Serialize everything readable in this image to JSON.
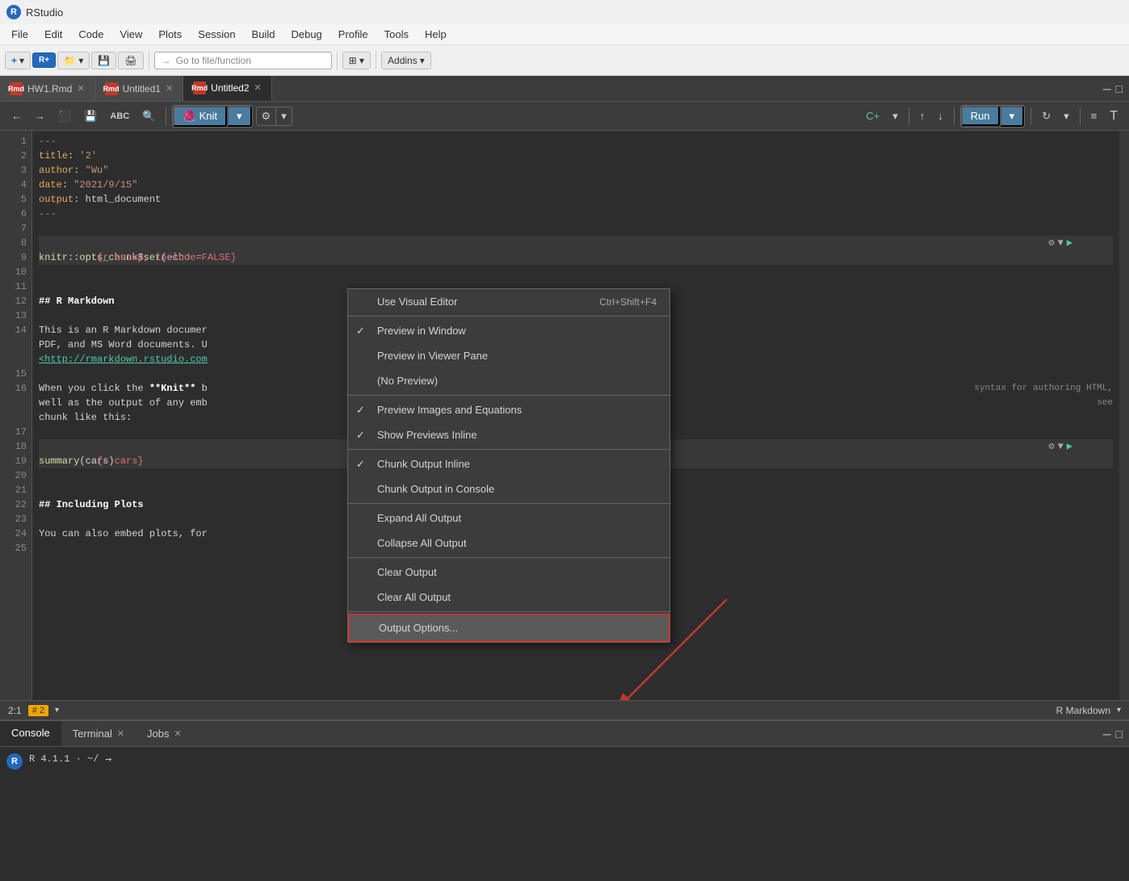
{
  "app": {
    "title": "RStudio",
    "icon_label": "R"
  },
  "menu": {
    "items": [
      "File",
      "Edit",
      "Code",
      "View",
      "Plots",
      "Session",
      "Build",
      "Debug",
      "Profile",
      "Tools",
      "Help"
    ]
  },
  "toolbar": {
    "goto_placeholder": "Go to file/function",
    "addins_label": "Addins"
  },
  "tabs": [
    {
      "label": "HW1.Rmd",
      "active": false
    },
    {
      "label": "Untitled1",
      "active": false
    },
    {
      "label": "Untitled2",
      "active": true
    }
  ],
  "editor_toolbar": {
    "back_label": "←",
    "forward_label": "→",
    "save_label": "💾",
    "abc_label": "ABC",
    "search_label": "🔍",
    "knit_label": "Knit",
    "settings_label": "⚙",
    "run_label": "Run",
    "up_label": "↑",
    "down_label": "↓"
  },
  "code_lines": [
    {
      "num": 1,
      "text": "---",
      "class": "cm"
    },
    {
      "num": 2,
      "text": "title: '2'",
      "class": ""
    },
    {
      "num": 3,
      "text": "author: \"Wu\"",
      "class": ""
    },
    {
      "num": 4,
      "text": "date: \"2021/9/15\"",
      "class": ""
    },
    {
      "num": 5,
      "text": "output: html_document",
      "class": ""
    },
    {
      "num": 6,
      "text": "---",
      "class": "cm"
    },
    {
      "num": 7,
      "text": "",
      "class": ""
    },
    {
      "num": 8,
      "text": "  {r setup, include=FALSE}",
      "class": "chunk-bg chunk-header"
    },
    {
      "num": 9,
      "text": "knitr::opts_chunk$set(echo =",
      "class": "chunk-bg"
    },
    {
      "num": 10,
      "text": "",
      "class": ""
    },
    {
      "num": 11,
      "text": "",
      "class": ""
    },
    {
      "num": 12,
      "text": "## R Markdown",
      "class": "h2"
    },
    {
      "num": 13,
      "text": "",
      "class": ""
    },
    {
      "num": 14,
      "text": "This is an R Markdown documen",
      "class": ""
    },
    {
      "num": 14,
      "text": "PDF, and MS Word documents. U",
      "class": ""
    },
    {
      "num": 14,
      "text": "<http://rmarkdown.rstudio.com",
      "class": "lnk"
    },
    {
      "num": 15,
      "text": "",
      "class": ""
    },
    {
      "num": 16,
      "text": "When you click the **Knit** b",
      "class": ""
    },
    {
      "num": 16,
      "text": "well as the output of any emb",
      "class": ""
    },
    {
      "num": 16,
      "text": "chunk like this:",
      "class": ""
    },
    {
      "num": 17,
      "text": "",
      "class": ""
    },
    {
      "num": 18,
      "text": "  {r cars}",
      "class": "chunk-bg chunk-header"
    },
    {
      "num": 19,
      "text": "summary(cars)",
      "class": "chunk-bg"
    },
    {
      "num": 20,
      "text": "",
      "class": ""
    },
    {
      "num": 21,
      "text": "",
      "class": ""
    },
    {
      "num": 22,
      "text": "## Including Plots",
      "class": "h2"
    },
    {
      "num": 23,
      "text": "",
      "class": ""
    },
    {
      "num": 24,
      "text": "You can also embed plots, for",
      "class": ""
    },
    {
      "num": 25,
      "text": "",
      "class": ""
    }
  ],
  "context_menu": {
    "items": [
      {
        "label": "Use Visual Editor",
        "shortcut": "Ctrl+Shift+F4",
        "checked": false,
        "id": "use-visual-editor"
      },
      {
        "separator": true
      },
      {
        "label": "Preview in Window",
        "checked": true,
        "id": "preview-in-window"
      },
      {
        "label": "Preview in Viewer Pane",
        "checked": false,
        "id": "preview-in-viewer-pane"
      },
      {
        "label": "(No Preview)",
        "checked": false,
        "id": "no-preview"
      },
      {
        "separator": true
      },
      {
        "label": "Preview Images and Equations",
        "checked": true,
        "id": "preview-images"
      },
      {
        "label": "Show Previews Inline",
        "checked": true,
        "id": "show-previews-inline"
      },
      {
        "separator": true
      },
      {
        "label": "Chunk Output Inline",
        "checked": true,
        "id": "chunk-output-inline"
      },
      {
        "label": "Chunk Output in Console",
        "checked": false,
        "id": "chunk-output-console"
      },
      {
        "separator": true
      },
      {
        "label": "Expand All Output",
        "checked": false,
        "id": "expand-all-output"
      },
      {
        "label": "Collapse All Output",
        "checked": false,
        "id": "collapse-all-output"
      },
      {
        "separator": true
      },
      {
        "label": "Clear Output",
        "checked": false,
        "id": "clear-output"
      },
      {
        "label": "Clear All Output",
        "checked": false,
        "id": "clear-all-output"
      },
      {
        "separator": true
      },
      {
        "label": "Output Options...",
        "checked": false,
        "id": "output-options",
        "highlighted": true
      }
    ]
  },
  "status_bar": {
    "position": "2:1",
    "number_label": "# 2",
    "language": "R Markdown"
  },
  "bottom_panel": {
    "tabs": [
      "Console",
      "Terminal",
      "Jobs"
    ],
    "console_text": "R 4.1.1 · ~/"
  }
}
